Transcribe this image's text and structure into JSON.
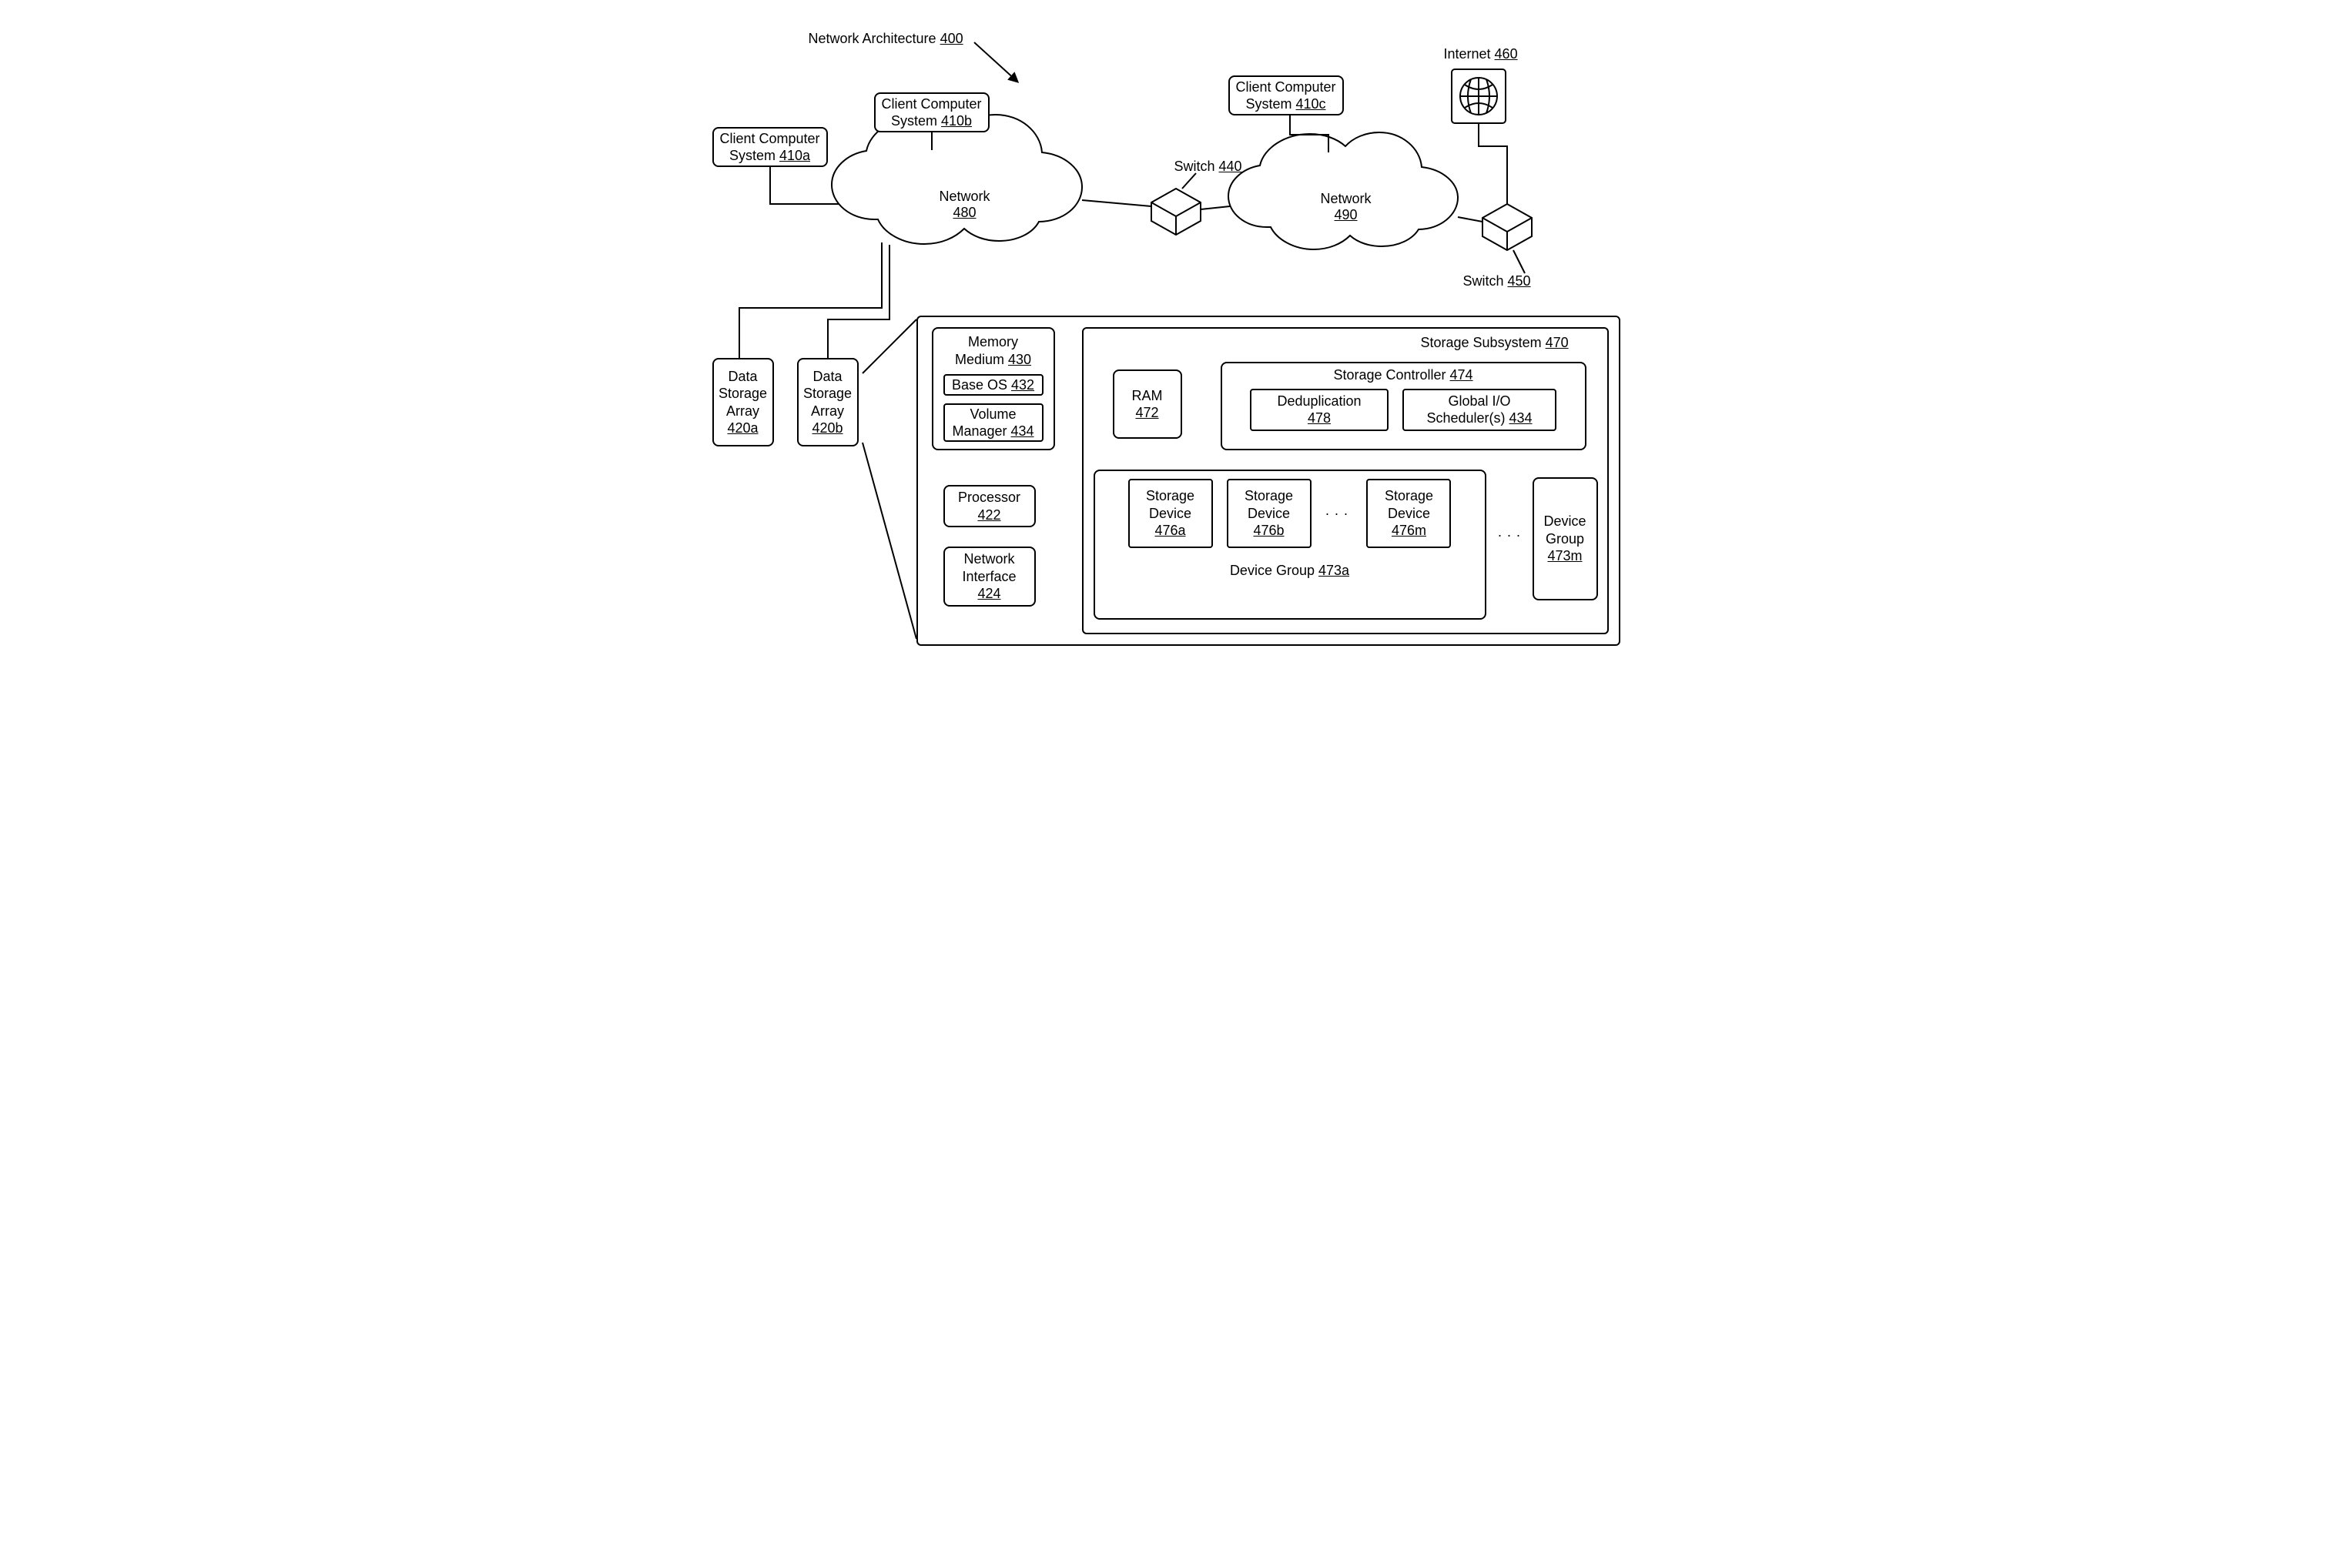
{
  "title": {
    "text": "Network Architecture ",
    "ref": "400"
  },
  "internet": {
    "text": "Internet ",
    "ref": "460"
  },
  "clients": {
    "a": {
      "l1": "Client Computer",
      "l2": "System ",
      "ref": "410a"
    },
    "b": {
      "l1": "Client Computer",
      "l2": "System ",
      "ref": "410b"
    },
    "c": {
      "l1": "Client Computer",
      "l2": "System ",
      "ref": "410c"
    }
  },
  "networks": {
    "left": {
      "l1": "Network",
      "ref": "480"
    },
    "right": {
      "l1": "Network",
      "ref": "490"
    }
  },
  "switches": {
    "mid": {
      "text": "Switch ",
      "ref": "440"
    },
    "right": {
      "text": "Switch ",
      "ref": "450"
    }
  },
  "dsa": {
    "a": {
      "l1": "Data",
      "l2": "Storage",
      "l3": "Array",
      "ref": "420a"
    },
    "b": {
      "l1": "Data",
      "l2": "Storage",
      "l3": "Array",
      "ref": "420b"
    }
  },
  "mm": {
    "l1": "Memory",
    "l2": "Medium ",
    "ref": "430"
  },
  "bos": {
    "text": "Base OS ",
    "ref": "432"
  },
  "vm": {
    "l1": "Volume",
    "l2": "Manager ",
    "ref": "434"
  },
  "proc": {
    "l1": "Processor",
    "ref": "422"
  },
  "nif": {
    "l1": "Network",
    "l2": "Interface",
    "ref": "424"
  },
  "subsys": {
    "text": "Storage Subsystem ",
    "ref": "470"
  },
  "ram": {
    "l1": "RAM",
    "ref": "472"
  },
  "sc": {
    "text": "Storage Controller ",
    "ref": "474"
  },
  "dedup": {
    "l1": "Deduplication",
    "ref": "478"
  },
  "gio": {
    "l1": "Global I/O",
    "l2": "Scheduler(s) ",
    "ref": "434"
  },
  "sd": {
    "a": {
      "l1": "Storage",
      "l2": "Device",
      "ref": "476a"
    },
    "b": {
      "l1": "Storage",
      "l2": "Device",
      "ref": "476b"
    },
    "m": {
      "l1": "Storage",
      "l2": "Device",
      "ref": "476m"
    }
  },
  "dg": {
    "a": {
      "text": "Device Group ",
      "ref": "473a"
    },
    "m": {
      "l1": "Device",
      "l2": "Group",
      "ref": "473m"
    }
  }
}
